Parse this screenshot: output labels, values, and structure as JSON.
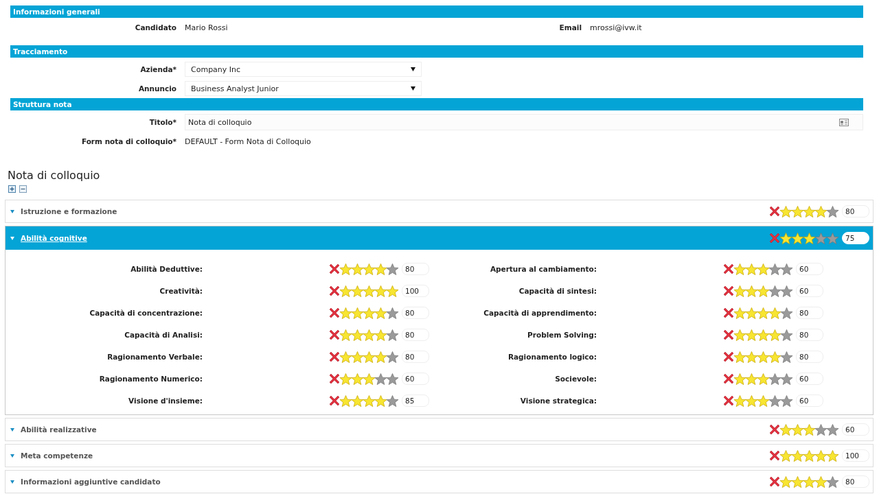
{
  "general": {
    "title": "Informazioni generali",
    "fields": [
      {
        "label": "Candidato",
        "value": "Mario Rossi"
      },
      {
        "label": "Email",
        "value": "mrossi@ivw.it"
      }
    ]
  },
  "tracking": {
    "title": "Tracciamento",
    "fields": [
      {
        "label": "Azienda*",
        "value": "Company Inc",
        "kind": "select"
      },
      {
        "label": "Annuncio",
        "value": "Business Analyst Junior",
        "kind": "select"
      }
    ]
  },
  "structure": {
    "title": "Struttura nota",
    "fields": [
      {
        "label": "Titolo*",
        "value": "Nota di colloquio",
        "kind": "input"
      },
      {
        "label": "Form nota di colloquio*",
        "value": "DEFAULT - Form Nota di Colloquio",
        "kind": "text"
      }
    ]
  },
  "note": {
    "heading": "Nota di colloquio",
    "groups": [
      {
        "title": "Istruzione e formazione",
        "expanded": false,
        "stars": 4,
        "score": "80"
      },
      {
        "title": "Abilità cognitive",
        "expanded": true,
        "stars": 3,
        "score": "75",
        "items": [
          {
            "label": "Abilità Deduttive:",
            "stars": 4,
            "score": "80"
          },
          {
            "label": "Apertura al cambiamento:",
            "stars": 3,
            "score": "60"
          },
          {
            "label": "Creatività:",
            "stars": 5,
            "score": "100"
          },
          {
            "label": "Capacità di sintesi:",
            "stars": 3,
            "score": "60"
          },
          {
            "label": "Capacità di concentrazione:",
            "stars": 4,
            "score": "80"
          },
          {
            "label": "Capacità di apprendimento:",
            "stars": 4,
            "score": "80"
          },
          {
            "label": "Capacità di Analisi:",
            "stars": 4,
            "score": "80"
          },
          {
            "label": "Problem Solving:",
            "stars": 4,
            "score": "80"
          },
          {
            "label": "Ragionamento Verbale:",
            "stars": 4,
            "score": "80"
          },
          {
            "label": "Ragionamento logico:",
            "stars": 4,
            "score": "80"
          },
          {
            "label": "Ragionamento Numerico:",
            "stars": 3,
            "score": "60"
          },
          {
            "label": "Socievole:",
            "stars": 3,
            "score": "60"
          },
          {
            "label": "Visione d'insieme:",
            "stars": 4,
            "score": "85"
          },
          {
            "label": "Visione strategica:",
            "stars": 3,
            "score": "60"
          }
        ]
      },
      {
        "title": "Abilità realizzative",
        "expanded": false,
        "stars": 3,
        "score": "60"
      },
      {
        "title": "Meta competenze",
        "expanded": false,
        "stars": 5,
        "score": "100"
      },
      {
        "title": "Informazioni aggiuntive candidato",
        "expanded": false,
        "stars": 4,
        "score": "80"
      }
    ]
  }
}
